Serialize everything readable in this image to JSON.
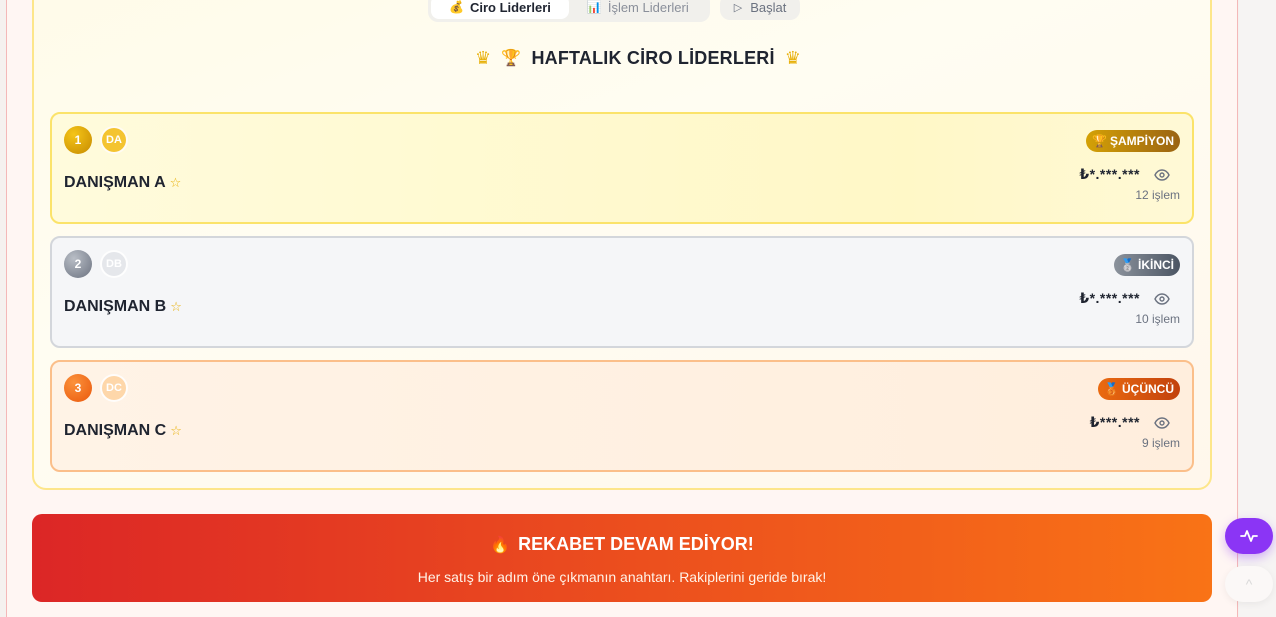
{
  "tabs": {
    "items": [
      {
        "icon": "💰",
        "label": "Ciro Liderleri",
        "active": true
      },
      {
        "icon": "📊",
        "label": "İşlem Liderleri",
        "active": false
      }
    ],
    "start_icon": "▷",
    "start_label": "Başlat"
  },
  "heading": {
    "crown_left": "♛",
    "trophy": "🏆",
    "title": "HAFTALIK CİRO LİDERLERİ",
    "crown_right": "♛"
  },
  "leaders": [
    {
      "rank": "1",
      "avatar": "DA",
      "name": "DANIŞMAN A",
      "star": "☆",
      "badge_icon": "🏆",
      "badge": "ŞAMPİYON",
      "amount": "₺*.***.***",
      "count": "12 işlem",
      "avatar_bg": "#f4c430"
    },
    {
      "rank": "2",
      "avatar": "DB",
      "name": "DANIŞMAN B",
      "star": "☆",
      "badge_icon": "🥈",
      "badge": "İKİNCİ",
      "amount": "₺*.***.***",
      "count": "10 işlem",
      "avatar_bg": "#e5e7eb"
    },
    {
      "rank": "3",
      "avatar": "DC",
      "name": "DANIŞMAN C",
      "star": "☆",
      "badge_icon": "🥉",
      "badge": "ÜÇÜNCÜ",
      "amount": "₺***.***",
      "count": "9 işlem",
      "avatar_bg": "#fed7aa"
    }
  ],
  "banner": {
    "icon": "🔥",
    "title": "REKABET DEVAM EDİYOR!",
    "subtitle": "Her satış bir adım öne çıkmanın anahtarı. Rakiplerini geride bırak!"
  },
  "fab": {
    "activity_icon": "activity-icon",
    "scroll_icon": "^"
  },
  "colors": {
    "accent_purple": "#8b35f5",
    "gold": "#e8b10c",
    "banner_start": "#dc2626",
    "banner_end": "#f97316"
  }
}
